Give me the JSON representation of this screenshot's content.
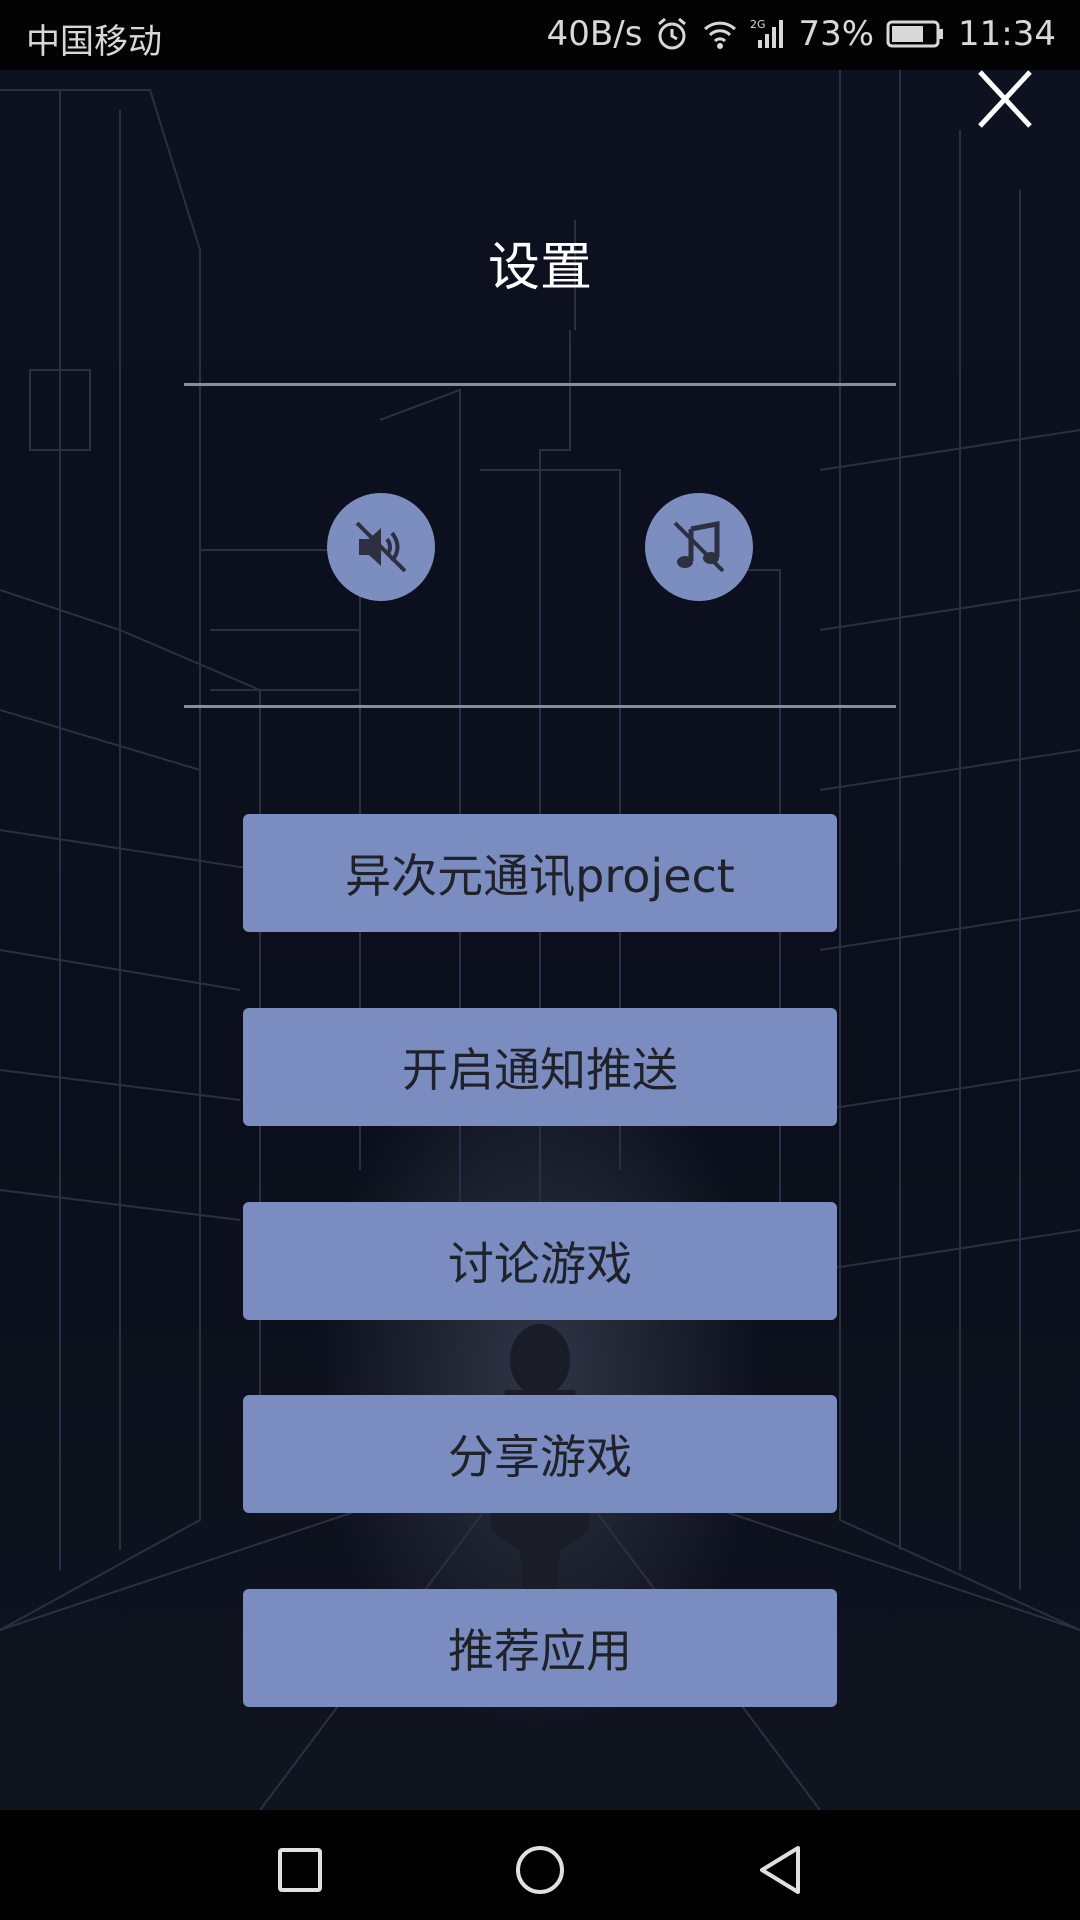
{
  "status_bar": {
    "carrier": "中国移动",
    "speed": "40B/s",
    "network": "2G",
    "battery_percent": "73%",
    "battery_level": 0.73,
    "time": "11:34",
    "icons": [
      "alarm-icon",
      "wifi-icon",
      "signal-icon",
      "battery-icon"
    ]
  },
  "header": {
    "title": "设置",
    "close_icon": "close-icon"
  },
  "toggles": {
    "sound": {
      "icon": "sound-muted-icon",
      "state": "off"
    },
    "music": {
      "icon": "music-off-icon",
      "state": "off"
    }
  },
  "menu": {
    "items": [
      {
        "label": "异次元通讯project"
      },
      {
        "label": "开启通知推送"
      },
      {
        "label": "讨论游戏"
      },
      {
        "label": "分享游戏"
      },
      {
        "label": "推荐应用"
      }
    ]
  },
  "nav_bar": {
    "icons": [
      "recent-apps-icon",
      "home-icon",
      "back-icon"
    ]
  },
  "colors": {
    "button": "#7b8dc0",
    "button_text": "#1f2229",
    "background": "#0b0e18",
    "divider": "#8a8e9c"
  }
}
